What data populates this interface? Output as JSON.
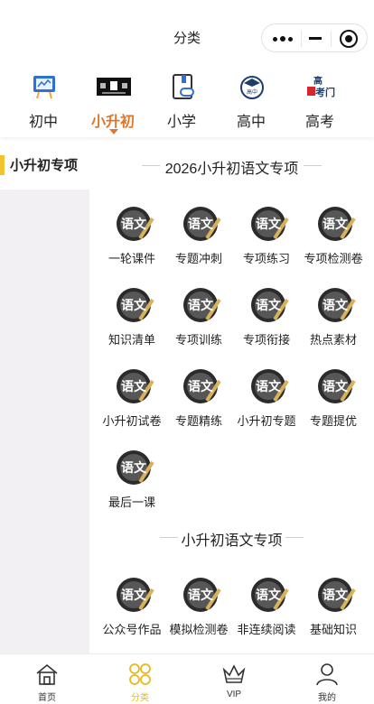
{
  "window": {
    "title": "分类"
  },
  "capsule": {
    "more_icon": "more-dots-icon",
    "minimize_icon": "minimize-icon",
    "close_icon": "target-close-icon"
  },
  "levels": [
    {
      "label": "初中",
      "icon": "chalkboard-icon",
      "active": false
    },
    {
      "label": "小升初",
      "icon": "graduate-banner-icon",
      "active": true
    },
    {
      "label": "小学",
      "icon": "book-link-icon",
      "active": false
    },
    {
      "label": "高中",
      "icon": "graduation-cap-icon",
      "active": false
    },
    {
      "label": "高考",
      "icon": "gaokao-icon",
      "active": false
    }
  ],
  "sidebar": {
    "items": [
      {
        "label": "小升初专项",
        "active": true
      }
    ]
  },
  "sections": [
    {
      "title": "2026小升初语文专项",
      "items": [
        {
          "label": "一轮课件"
        },
        {
          "label": "专题冲刺"
        },
        {
          "label": "专项练习"
        },
        {
          "label": "专项检测卷"
        },
        {
          "label": "知识清单"
        },
        {
          "label": "专项训练"
        },
        {
          "label": "专项衔接"
        },
        {
          "label": "热点素材"
        },
        {
          "label": "小升初试卷"
        },
        {
          "label": "专题精练"
        },
        {
          "label": "小升初专题"
        },
        {
          "label": "专题提优"
        },
        {
          "label": "最后一课"
        }
      ]
    },
    {
      "title": "小升初语文专项",
      "items": [
        {
          "label": "公众号作品"
        },
        {
          "label": "模拟检测卷"
        },
        {
          "label": "非连续阅读"
        },
        {
          "label": "基础知识"
        }
      ]
    }
  ],
  "badge_text": "语文",
  "bottom_nav": [
    {
      "label": "首页",
      "icon": "home-icon",
      "active": false
    },
    {
      "label": "分类",
      "icon": "category-icon",
      "active": true
    },
    {
      "label": "VIP",
      "icon": "crown-icon",
      "active": false
    },
    {
      "label": "我的",
      "icon": "user-icon",
      "active": false
    }
  ],
  "colors": {
    "accent_orange": "#e0762a",
    "accent_yellow": "#f2c230",
    "nav_active": "#e9b81c",
    "sidebar_bg": "#f3f0f3"
  }
}
